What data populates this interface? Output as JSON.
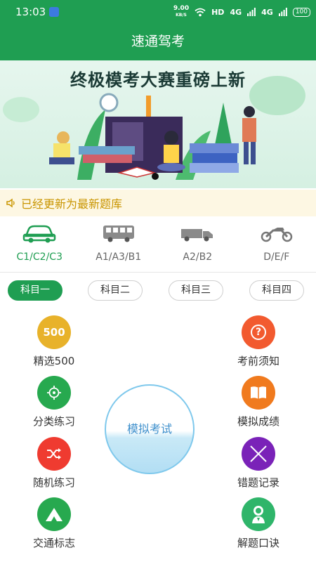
{
  "status_bar": {
    "time": "13:03",
    "net_speed_value": "9.00",
    "net_speed_unit": "KB/S",
    "hd_label": "HD",
    "signal1": "4G",
    "signal2": "4G",
    "battery": "100"
  },
  "app_title": "速通驾考",
  "banner": {
    "title": "终极模考大赛重磅上新"
  },
  "notice": {
    "text": "已经更新为最新题库"
  },
  "licenses": [
    {
      "label": "C1/C2/C3",
      "icon": "car-icon"
    },
    {
      "label": "A1/A3/B1",
      "icon": "bus-icon"
    },
    {
      "label": "A2/B2",
      "icon": "truck-icon"
    },
    {
      "label": "D/E/F",
      "icon": "motorcycle-icon"
    }
  ],
  "subjects": [
    {
      "label": "科目一"
    },
    {
      "label": "科目二"
    },
    {
      "label": "科目三"
    },
    {
      "label": "科目四"
    }
  ],
  "features_left": [
    {
      "label": "精选500",
      "icon": "500-badge-icon",
      "icon_text": "500",
      "color": "#e8b22a"
    },
    {
      "label": "分类练习",
      "icon": "crosshair-icon",
      "color": "#27a94f"
    },
    {
      "label": "随机练习",
      "icon": "shuffle-icon",
      "color": "#ef3b30"
    },
    {
      "label": "交通标志",
      "icon": "mountain-sign-icon",
      "color": "#27a94f"
    }
  ],
  "features_right": [
    {
      "label": "考前须知",
      "icon": "question-icon",
      "icon_text": "?",
      "color": "#f25a2f"
    },
    {
      "label": "模拟成绩",
      "icon": "book-icon",
      "color": "#f07a1e"
    },
    {
      "label": "错题记录",
      "icon": "x-mark-icon",
      "color": "#7a22b8"
    },
    {
      "label": "解题口诀",
      "icon": "person-badge-icon",
      "color": "#2fb56a"
    }
  ],
  "mock_exam": {
    "label": "模拟考试"
  }
}
